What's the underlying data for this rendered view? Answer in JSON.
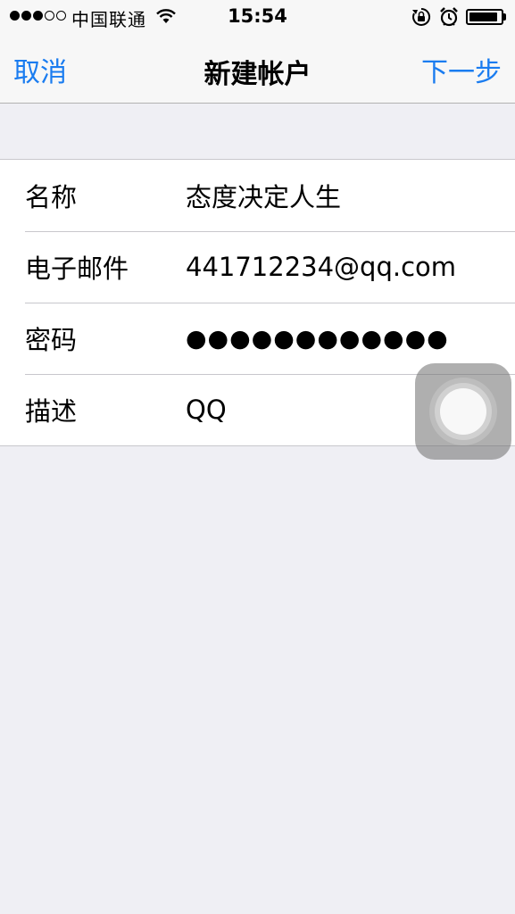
{
  "status_bar": {
    "signal_bars_filled": 3,
    "signal_bars_total": 5,
    "carrier": "中国联通",
    "time": "15:54",
    "battery_level": 0.9
  },
  "nav": {
    "left_label": "取消",
    "title": "新建帐户",
    "right_label": "下一步",
    "accent_color": "#1a7cf0"
  },
  "form": {
    "rows": [
      {
        "label": "名称",
        "value": "态度决定人生"
      },
      {
        "label": "电子邮件",
        "value": "441712234@qq.com"
      },
      {
        "label": "密码",
        "value": "●●●●●●●●●●●●"
      },
      {
        "label": "描述",
        "value": "QQ"
      }
    ]
  },
  "icons": {
    "wifi": "wifi-icon",
    "rotation_lock": "rotation-lock-icon",
    "alarm": "alarm-icon",
    "battery": "battery-icon",
    "assistive_touch": "assistive-touch-icon"
  }
}
